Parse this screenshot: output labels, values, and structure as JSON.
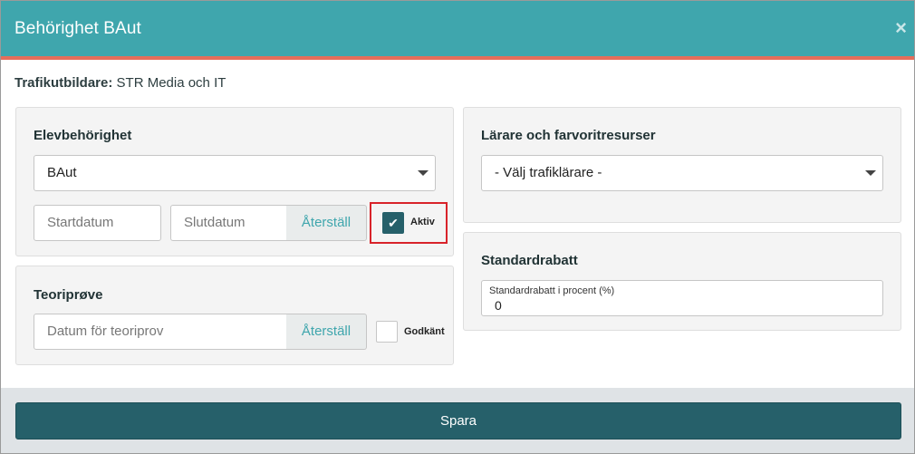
{
  "modal": {
    "title": "Behörighet BAut",
    "close": "×"
  },
  "school": {
    "label": "Trafikutbildare:",
    "value": " STR Media och IT"
  },
  "student_auth": {
    "title": "Elevbehörighet",
    "license_select": "BAut",
    "start_date_placeholder": "Startdatum",
    "end_date_placeholder": "Slutdatum",
    "reset_label": "Återställ",
    "active_label": "Aktiv",
    "active_checked": true
  },
  "theory": {
    "title": "Teoriprøve",
    "date_placeholder": "Datum för teoriprov",
    "reset_label": "Återställ",
    "approved_label": "Godkänt",
    "approved_checked": false
  },
  "teachers": {
    "title": "Lärare och farvoritresurser",
    "select_value": "- Välj trafiklärare -"
  },
  "discount": {
    "title": "Standardrabatt",
    "field_label": "Standardrabatt i procent (%)",
    "field_value": "0"
  },
  "footer": {
    "save_label": "Spara"
  },
  "colors": {
    "header": "#3fa6ad",
    "header_border": "#e56e5b",
    "primary": "#26606a",
    "highlight": "#d8232a"
  }
}
